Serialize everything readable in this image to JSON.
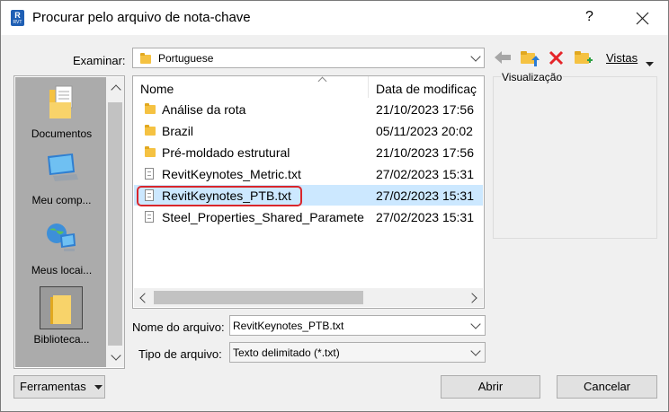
{
  "window": {
    "title": "Procurar pelo arquivo de nota-chave",
    "app_icon_letter": "R",
    "app_icon_sub": "RVT",
    "help_label": "?"
  },
  "lookin": {
    "label": "Examinar:",
    "value": "Portuguese"
  },
  "toolbar": {
    "views_label": "Vistas"
  },
  "places": [
    {
      "label": "Documentos",
      "icon": "documents-icon"
    },
    {
      "label": "Meu comp...",
      "icon": "computer-icon"
    },
    {
      "label": "Meus locai...",
      "icon": "network-icon"
    },
    {
      "label": "Biblioteca...",
      "icon": "library-folder-icon",
      "selected": true
    }
  ],
  "filelist": {
    "columns": {
      "name": "Nome",
      "date": "Data de modificaç"
    },
    "rows": [
      {
        "name": "Análise da rota",
        "date": "21/10/2023 17:56",
        "type": "folder"
      },
      {
        "name": "Brazil",
        "date": "05/11/2023 20:02",
        "type": "folder"
      },
      {
        "name": "Pré-moldado estrutural",
        "date": "21/10/2023 17:56",
        "type": "folder"
      },
      {
        "name": "RevitKeynotes_Metric.txt",
        "date": "27/02/2023 15:31",
        "type": "txt"
      },
      {
        "name": "RevitKeynotes_PTB.txt",
        "date": "27/02/2023 15:31",
        "type": "txt",
        "selected": true
      },
      {
        "name": "Steel_Properties_Shared_Paramete",
        "date": "27/02/2023 15:31",
        "type": "txt"
      }
    ]
  },
  "preview": {
    "label": "Visualização"
  },
  "filename": {
    "label": "Nome do arquivo:",
    "value": "RevitKeynotes_PTB.txt"
  },
  "filetype": {
    "label": "Tipo de arquivo:",
    "value": "Texto delimitado (*.txt)"
  },
  "buttons": {
    "tools": "Ferramentas",
    "open": "Abrir",
    "cancel": "Cancelar"
  },
  "colors": {
    "selection": "#cce8ff",
    "highlight": "#d9262b",
    "delete": "#e5252a",
    "folder": "#f5c242"
  }
}
